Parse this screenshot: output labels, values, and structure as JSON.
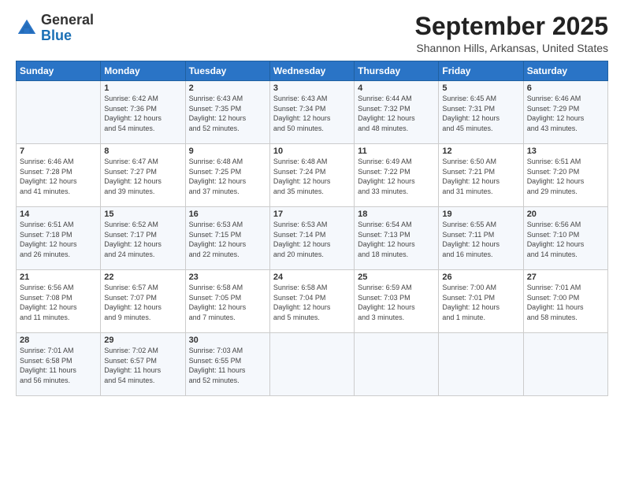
{
  "logo": {
    "general": "General",
    "blue": "Blue"
  },
  "title": "September 2025",
  "location": "Shannon Hills, Arkansas, United States",
  "weekdays": [
    "Sunday",
    "Monday",
    "Tuesday",
    "Wednesday",
    "Thursday",
    "Friday",
    "Saturday"
  ],
  "weeks": [
    [
      {
        "day": "",
        "info": ""
      },
      {
        "day": "1",
        "info": "Sunrise: 6:42 AM\nSunset: 7:36 PM\nDaylight: 12 hours\nand 54 minutes."
      },
      {
        "day": "2",
        "info": "Sunrise: 6:43 AM\nSunset: 7:35 PM\nDaylight: 12 hours\nand 52 minutes."
      },
      {
        "day": "3",
        "info": "Sunrise: 6:43 AM\nSunset: 7:34 PM\nDaylight: 12 hours\nand 50 minutes."
      },
      {
        "day": "4",
        "info": "Sunrise: 6:44 AM\nSunset: 7:32 PM\nDaylight: 12 hours\nand 48 minutes."
      },
      {
        "day": "5",
        "info": "Sunrise: 6:45 AM\nSunset: 7:31 PM\nDaylight: 12 hours\nand 45 minutes."
      },
      {
        "day": "6",
        "info": "Sunrise: 6:46 AM\nSunset: 7:29 PM\nDaylight: 12 hours\nand 43 minutes."
      }
    ],
    [
      {
        "day": "7",
        "info": "Sunrise: 6:46 AM\nSunset: 7:28 PM\nDaylight: 12 hours\nand 41 minutes."
      },
      {
        "day": "8",
        "info": "Sunrise: 6:47 AM\nSunset: 7:27 PM\nDaylight: 12 hours\nand 39 minutes."
      },
      {
        "day": "9",
        "info": "Sunrise: 6:48 AM\nSunset: 7:25 PM\nDaylight: 12 hours\nand 37 minutes."
      },
      {
        "day": "10",
        "info": "Sunrise: 6:48 AM\nSunset: 7:24 PM\nDaylight: 12 hours\nand 35 minutes."
      },
      {
        "day": "11",
        "info": "Sunrise: 6:49 AM\nSunset: 7:22 PM\nDaylight: 12 hours\nand 33 minutes."
      },
      {
        "day": "12",
        "info": "Sunrise: 6:50 AM\nSunset: 7:21 PM\nDaylight: 12 hours\nand 31 minutes."
      },
      {
        "day": "13",
        "info": "Sunrise: 6:51 AM\nSunset: 7:20 PM\nDaylight: 12 hours\nand 29 minutes."
      }
    ],
    [
      {
        "day": "14",
        "info": "Sunrise: 6:51 AM\nSunset: 7:18 PM\nDaylight: 12 hours\nand 26 minutes."
      },
      {
        "day": "15",
        "info": "Sunrise: 6:52 AM\nSunset: 7:17 PM\nDaylight: 12 hours\nand 24 minutes."
      },
      {
        "day": "16",
        "info": "Sunrise: 6:53 AM\nSunset: 7:15 PM\nDaylight: 12 hours\nand 22 minutes."
      },
      {
        "day": "17",
        "info": "Sunrise: 6:53 AM\nSunset: 7:14 PM\nDaylight: 12 hours\nand 20 minutes."
      },
      {
        "day": "18",
        "info": "Sunrise: 6:54 AM\nSunset: 7:13 PM\nDaylight: 12 hours\nand 18 minutes."
      },
      {
        "day": "19",
        "info": "Sunrise: 6:55 AM\nSunset: 7:11 PM\nDaylight: 12 hours\nand 16 minutes."
      },
      {
        "day": "20",
        "info": "Sunrise: 6:56 AM\nSunset: 7:10 PM\nDaylight: 12 hours\nand 14 minutes."
      }
    ],
    [
      {
        "day": "21",
        "info": "Sunrise: 6:56 AM\nSunset: 7:08 PM\nDaylight: 12 hours\nand 11 minutes."
      },
      {
        "day": "22",
        "info": "Sunrise: 6:57 AM\nSunset: 7:07 PM\nDaylight: 12 hours\nand 9 minutes."
      },
      {
        "day": "23",
        "info": "Sunrise: 6:58 AM\nSunset: 7:05 PM\nDaylight: 12 hours\nand 7 minutes."
      },
      {
        "day": "24",
        "info": "Sunrise: 6:58 AM\nSunset: 7:04 PM\nDaylight: 12 hours\nand 5 minutes."
      },
      {
        "day": "25",
        "info": "Sunrise: 6:59 AM\nSunset: 7:03 PM\nDaylight: 12 hours\nand 3 minutes."
      },
      {
        "day": "26",
        "info": "Sunrise: 7:00 AM\nSunset: 7:01 PM\nDaylight: 12 hours\nand 1 minute."
      },
      {
        "day": "27",
        "info": "Sunrise: 7:01 AM\nSunset: 7:00 PM\nDaylight: 11 hours\nand 58 minutes."
      }
    ],
    [
      {
        "day": "28",
        "info": "Sunrise: 7:01 AM\nSunset: 6:58 PM\nDaylight: 11 hours\nand 56 minutes."
      },
      {
        "day": "29",
        "info": "Sunrise: 7:02 AM\nSunset: 6:57 PM\nDaylight: 11 hours\nand 54 minutes."
      },
      {
        "day": "30",
        "info": "Sunrise: 7:03 AM\nSunset: 6:55 PM\nDaylight: 11 hours\nand 52 minutes."
      },
      {
        "day": "",
        "info": ""
      },
      {
        "day": "",
        "info": ""
      },
      {
        "day": "",
        "info": ""
      },
      {
        "day": "",
        "info": ""
      }
    ]
  ]
}
